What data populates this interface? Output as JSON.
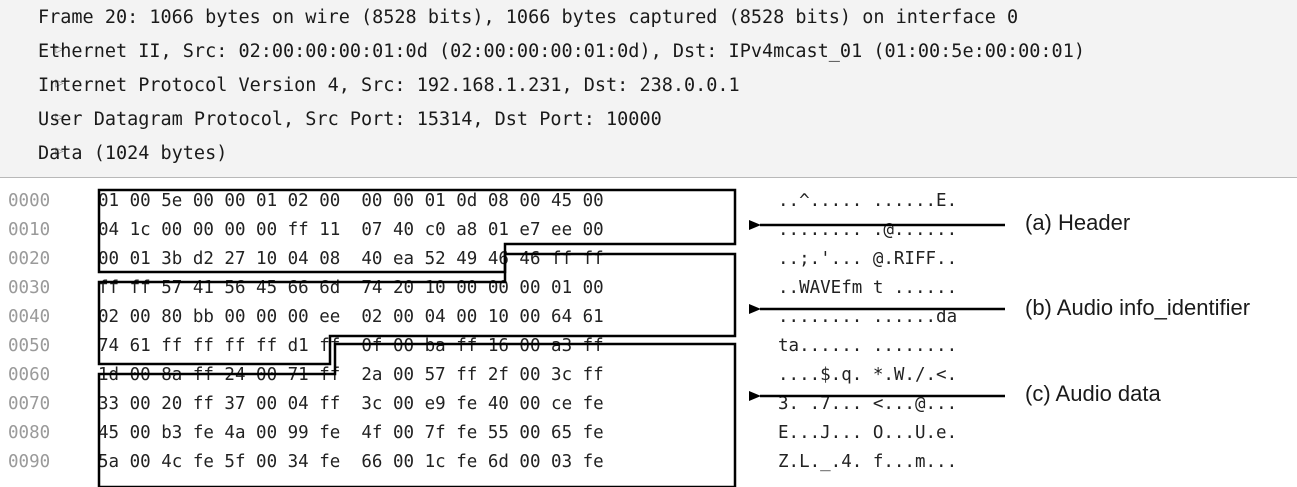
{
  "tree": [
    {
      "text": "Frame 20: 1066 bytes on wire (8528 bits), 1066 bytes captured (8528 bits) on interface 0"
    },
    {
      "text": "Ethernet II, Src: 02:00:00:00:01:0d (02:00:00:00:01:0d), Dst: IPv4mcast_01 (01:00:5e:00:00:01)"
    },
    {
      "text": "Internet Protocol Version 4, Src: 192.168.1.231, Dst: 238.0.0.1"
    },
    {
      "text": "User Datagram Protocol, Src Port: 15314, Dst Port: 10000"
    },
    {
      "text": "Data (1024 bytes)"
    }
  ],
  "hex_rows": [
    {
      "offset": "0000",
      "bytes": "01 00 5e 00 00 01 02 00  00 00 01 0d 08 00 45 00",
      "ascii": "..^..... ......E."
    },
    {
      "offset": "0010",
      "bytes": "04 1c 00 00 00 00 ff 11  07 40 c0 a8 01 e7 ee 00",
      "ascii": "........ .@......"
    },
    {
      "offset": "0020",
      "bytes": "00 01 3b d2 27 10 04 08  40 ea 52 49 46 46 ff ff",
      "ascii": "..;.'... @.RIFF.."
    },
    {
      "offset": "0030",
      "bytes": "ff ff 57 41 56 45 66 6d  74 20 10 00 00 00 01 00",
      "ascii": "..WAVEfm t ......"
    },
    {
      "offset": "0040",
      "bytes": "02 00 80 bb 00 00 00 ee  02 00 04 00 10 00 64 61",
      "ascii": "........ ......da"
    },
    {
      "offset": "0050",
      "bytes": "74 61 ff ff ff ff d1 ff  0f 00 ba ff 16 00 a3 ff",
      "ascii": "ta...... ........"
    },
    {
      "offset": "0060",
      "bytes": "1d 00 8a ff 24 00 71 ff  2a 00 57 ff 2f 00 3c ff",
      "ascii": "....$.q. *.W./.<."
    },
    {
      "offset": "0070",
      "bytes": "33 00 20 ff 37 00 04 ff  3c 00 e9 fe 40 00 ce fe",
      "ascii": "3. .7... <...@..."
    },
    {
      "offset": "0080",
      "bytes": "45 00 b3 fe 4a 00 99 fe  4f 00 7f fe 55 00 65 fe",
      "ascii": "E...J... O...U.e."
    },
    {
      "offset": "0090",
      "bytes": "5a 00 4c fe 5f 00 34 fe  66 00 1c fe 6d 00 03 fe",
      "ascii": "Z.L._.4. f...m..."
    }
  ],
  "annotations": {
    "header": "(a) Header",
    "audio_info": "(b) Audio info_identifier",
    "audio_data": "(c) Audio data"
  },
  "icons": {
    "expand": "triangle-right-icon"
  },
  "colors": {
    "tree_bg": "#f3f3f3",
    "offset_text": "#9a9a9a",
    "box_line": "#000000"
  }
}
